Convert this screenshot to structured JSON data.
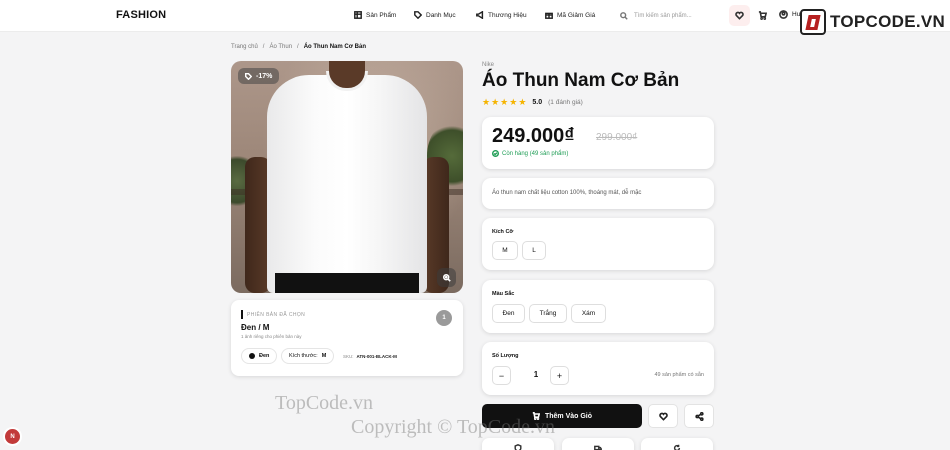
{
  "header": {
    "brand": "FASHION",
    "nav": [
      {
        "label": "Sản Phẩm",
        "icon": "grid-icon"
      },
      {
        "label": "Danh Mục",
        "icon": "tag-icon"
      },
      {
        "label": "Thương Hiệu",
        "icon": "megaphone-icon"
      },
      {
        "label": "Mã Giảm Giá",
        "icon": "gift-icon"
      }
    ],
    "search_placeholder": "Tìm kiếm sản phẩm...",
    "user_label": "Hu"
  },
  "watermark": {
    "logo_text": "TOPCODE.VN",
    "line1": "TopCode.vn",
    "line2": "Copyright © TopCode.vn"
  },
  "breadcrumb": [
    "Trang chủ",
    "Áo Thun",
    "Áo Thun Nam Cơ Bản"
  ],
  "gallery": {
    "discount_badge": "-17%"
  },
  "variant": {
    "section_label": "PHIÊN BẢN ĐÃ CHỌN",
    "value": "Đen / M",
    "note": "1 ảnh riêng cho phiên bản này",
    "count": "1",
    "color_chip": "Đen",
    "size_chip_label": "Kích thước:",
    "size_chip_value": "M",
    "sku_label": "SKU:",
    "sku_value": "ATN-001-BLACK-M"
  },
  "product": {
    "brand": "Nike",
    "title": "Áo Thun Nam Cơ Bản",
    "rating_stars": 5,
    "rating_score": "5.0",
    "review_count": "(1 đánh giá)",
    "price": "249.000₫",
    "old_price": "299.000₫",
    "stock": "Còn hàng (49 sản phẩm)",
    "description": "Áo thun nam chất liệu cotton 100%, thoáng mát, dễ mặc"
  },
  "options": {
    "size_title": "Kích Cỡ",
    "sizes": [
      "M",
      "L"
    ],
    "color_title": "Màu Sắc",
    "colors": [
      "Đen",
      "Trắng",
      "Xám"
    ]
  },
  "quantity": {
    "title": "Số Lượng",
    "minus": "−",
    "value": "1",
    "plus": "+",
    "available": "49 sản phẩm có sẵn"
  },
  "actions": {
    "add_to_cart": "Thêm Vào Giỏ"
  },
  "fab": {
    "initial": "N"
  }
}
